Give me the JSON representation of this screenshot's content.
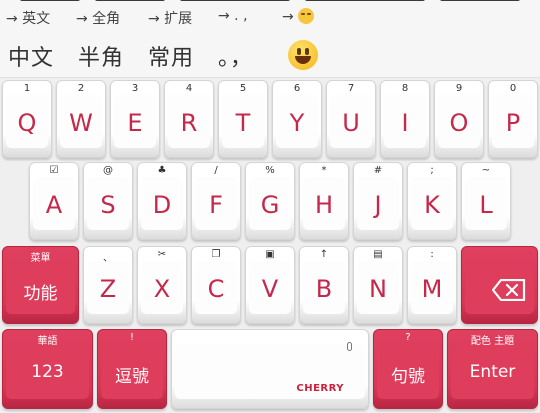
{
  "hint_bar": {
    "hints": [
      "→ 英文",
      "→ 全角",
      "→ 扩展",
      "→ . ,",
      "→"
    ],
    "last_hint_icon": "sad-face-emoji"
  },
  "candidates": {
    "items": [
      "中文",
      "半角",
      "常用",
      "。，"
    ],
    "emoji_icon": "smiley-face-emoji"
  },
  "keyboard": {
    "row1": [
      {
        "sym": "1",
        "label": "Q"
      },
      {
        "sym": "2",
        "label": "W"
      },
      {
        "sym": "3",
        "label": "E"
      },
      {
        "sym": "4",
        "label": "R"
      },
      {
        "sym": "5",
        "label": "T"
      },
      {
        "sym": "6",
        "label": "Y"
      },
      {
        "sym": "7",
        "label": "U"
      },
      {
        "sym": "8",
        "label": "I"
      },
      {
        "sym": "9",
        "label": "O"
      },
      {
        "sym": "0",
        "label": "P"
      }
    ],
    "row2": [
      {
        "sym": "☑",
        "label": "A"
      },
      {
        "sym": "@",
        "label": "S"
      },
      {
        "sym": "♣",
        "label": "D"
      },
      {
        "sym": "/",
        "label": "F"
      },
      {
        "sym": "%",
        "label": "G"
      },
      {
        "sym": "*",
        "label": "H"
      },
      {
        "sym": "#",
        "label": "J"
      },
      {
        "sym": ";",
        "label": "K"
      },
      {
        "sym": "~",
        "label": "L"
      }
    ],
    "row3": [
      {
        "sym": "、",
        "label": "Z"
      },
      {
        "sym": "✂",
        "label": "X"
      },
      {
        "sym": "❐",
        "label": "C"
      },
      {
        "sym": "▣",
        "label": "V"
      },
      {
        "sym": "↑",
        "label": "B"
      },
      {
        "sym": "▤",
        "label": "N"
      },
      {
        "sym": ":",
        "label": "M"
      }
    ],
    "func_key": {
      "sym": "菜單",
      "label": "功能"
    },
    "backspace_icon": "backspace-icon",
    "num_key": {
      "sym": "華語",
      "label": "123"
    },
    "comma_key": {
      "sym": "!",
      "label": "逗號"
    },
    "period_key": {
      "sym": "?",
      "label": "句號"
    },
    "enter_key": {
      "sym": "配色 主題",
      "label": "Enter"
    },
    "space_brand": "CHERRY",
    "accent_red": "#d93556",
    "letter_red": "#c4284a"
  }
}
